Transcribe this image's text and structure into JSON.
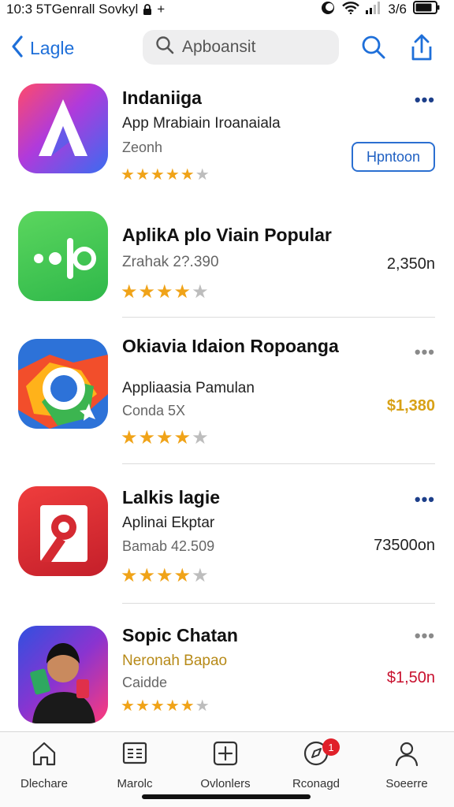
{
  "status_bar": {
    "left_text": "10:3 5TGenrall Sovkyl",
    "plus": "+",
    "battery_text": "3/6"
  },
  "nav": {
    "back_label": "Lagle",
    "search_placeholder": "Apboansit"
  },
  "apps": [
    {
      "title": "Indaniiga",
      "subtitle": "App Mrabiain Iroanaiala",
      "meta": "Zeonh",
      "rating": 4.5,
      "action_label": "Hpntoon",
      "price": "",
      "more": "•••",
      "icon": "letter-a-gradient-icon"
    },
    {
      "title": "AplikA plo Viain Popular",
      "subtitle": "",
      "meta": "Zrahak 2?.390",
      "rating": 4,
      "action_label": "",
      "price": "2,350n",
      "more": "",
      "icon": "green-dots-icon"
    },
    {
      "title": "Okiavia Idaion Ropoanga",
      "subtitle": "Appliaasia Pamulan",
      "meta": "Conda 5X",
      "rating": 4,
      "action_label": "",
      "price": "$1,380",
      "more": "•••",
      "icon": "colorful-ring-icon"
    },
    {
      "title": "Lalkis lagie",
      "subtitle": "Aplinai Ekptar",
      "meta": "Bamab 42.509",
      "rating": 4,
      "action_label": "",
      "price": "73500on",
      "more": "•••",
      "icon": "red-key-icon"
    },
    {
      "title": "Sopic Chatan",
      "subtitle": "Neronah Bapao",
      "meta": "Caidde",
      "rating": 4.5,
      "action_label": "",
      "price": "$1,50n",
      "more": "•••",
      "icon": "person-photo-icon"
    }
  ],
  "tabs": [
    {
      "label": "Dlechare",
      "icon": "house-icon"
    },
    {
      "label": "Marolc",
      "icon": "grid-icon"
    },
    {
      "label": "Ovlonlers",
      "icon": "plus-square-icon"
    },
    {
      "label": "Rconagd",
      "icon": "compass-icon",
      "badge": "1"
    },
    {
      "label": "Soeerre",
      "icon": "person-icon"
    }
  ],
  "colors": {
    "accent": "#1e6fd9",
    "star": "#f0a318",
    "price_gold": "#d8a116",
    "price_red": "#c8102e",
    "badge": "#e0202a"
  }
}
